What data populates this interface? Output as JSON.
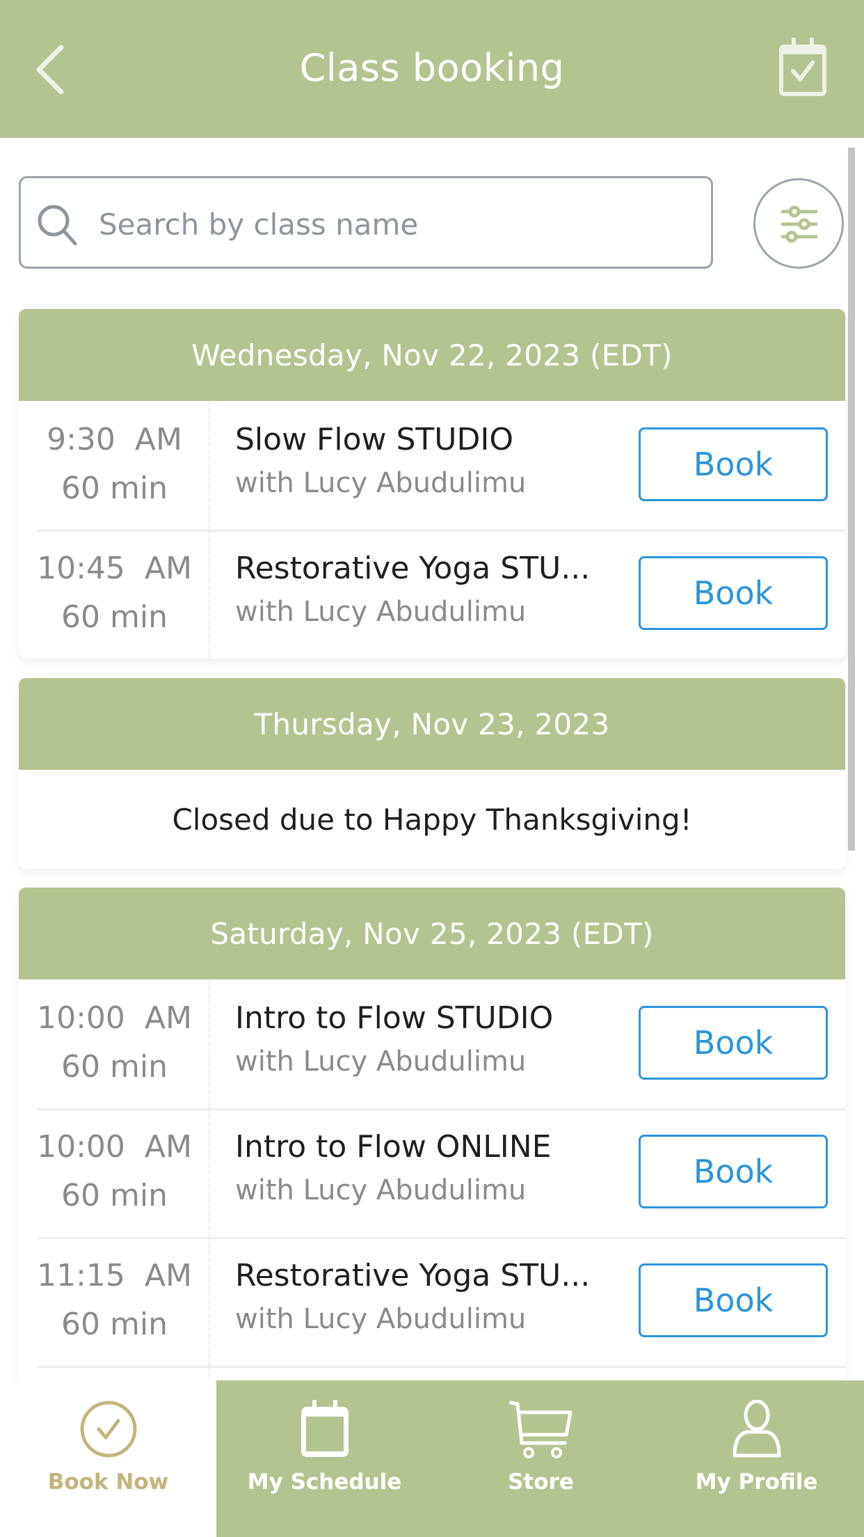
{
  "header": {
    "title": "Class booking",
    "back_icon": "chevron-left-icon",
    "calendar_icon": "calendar-check-icon"
  },
  "search": {
    "placeholder": "Search by class name",
    "value": "",
    "icon": "search-icon",
    "filter_icon": "sliders-icon"
  },
  "colors": {
    "brand_green": "#b3c490",
    "book_blue": "#2b95dd",
    "active_gold": "#c3b47c"
  },
  "days": [
    {
      "header": "Wednesday, Nov 22, 2023 (EDT)",
      "classes": [
        {
          "time": "9:30  AM",
          "duration": "60 min",
          "name": "Slow Flow STUDIO",
          "instructor": "with Lucy Abudulimu",
          "action": "Book"
        },
        {
          "time": "10:45  AM",
          "duration": "60 min",
          "name": "Restorative Yoga STU...",
          "instructor": "with Lucy Abudulimu",
          "action": "Book"
        }
      ]
    },
    {
      "header": "Thursday, Nov 23, 2023",
      "notice": "Closed due to Happy Thanksgiving!"
    },
    {
      "header": "Saturday, Nov 25, 2023 (EDT)",
      "classes": [
        {
          "time": "10:00  AM",
          "duration": "60 min",
          "name": "Intro to Flow STUDIO",
          "instructor": "with Lucy Abudulimu",
          "action": "Book"
        },
        {
          "time": "10:00  AM",
          "duration": "60 min",
          "name": "Intro to Flow ONLINE",
          "instructor": "with Lucy Abudulimu",
          "action": "Book"
        },
        {
          "time": "11:15  AM",
          "duration": "60 min",
          "name": "Restorative Yoga STU...",
          "instructor": "with Lucy Abudulimu",
          "action": "Book"
        }
      ]
    }
  ],
  "bottom_nav": [
    {
      "label": "Book Now",
      "icon": "check-circle-icon",
      "active": true
    },
    {
      "label": "My Schedule",
      "icon": "calendar-icon",
      "active": false
    },
    {
      "label": "Store",
      "icon": "cart-icon",
      "active": false
    },
    {
      "label": "My Profile",
      "icon": "user-icon",
      "active": false
    }
  ]
}
